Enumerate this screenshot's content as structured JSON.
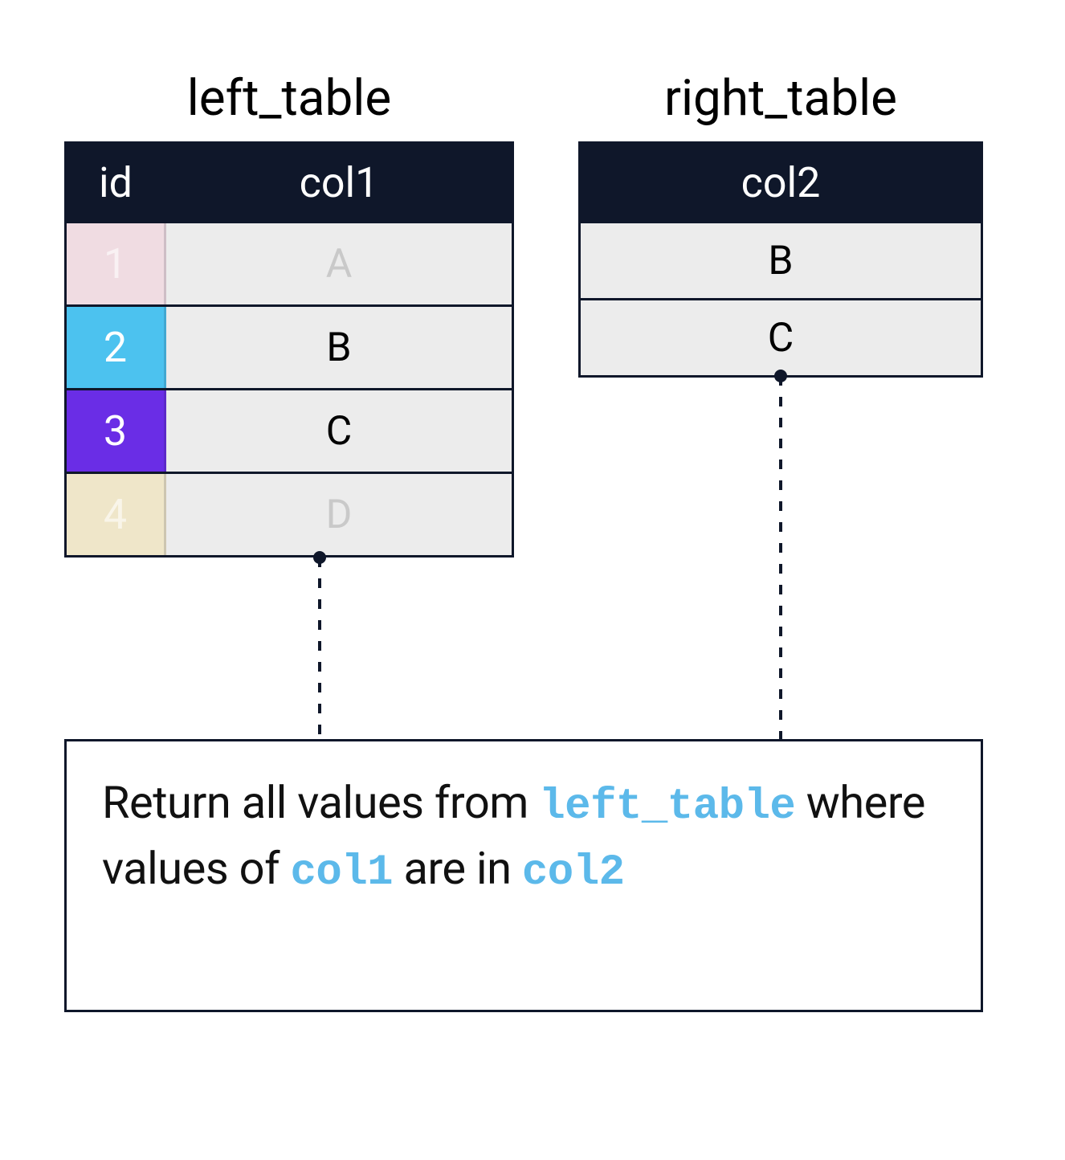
{
  "left_table": {
    "title": "left_table",
    "headers": {
      "id": "id",
      "col1": "col1"
    },
    "rows": [
      {
        "id": "1",
        "col1": "A",
        "id_bg": "#f0dce2",
        "faded": true
      },
      {
        "id": "2",
        "col1": "B",
        "id_bg": "#4cc2ef",
        "faded": false
      },
      {
        "id": "3",
        "col1": "C",
        "id_bg": "#6a2de6",
        "faded": false
      },
      {
        "id": "4",
        "col1": "D",
        "id_bg": "#efe6c9",
        "faded": true
      }
    ]
  },
  "right_table": {
    "title": "right_table",
    "headers": {
      "col2": "col2"
    },
    "rows": [
      {
        "col2": "B"
      },
      {
        "col2": "C"
      }
    ]
  },
  "explanation": {
    "part1": "Return all values from ",
    "token1": "left_table",
    "part2": " where values of ",
    "token2": "col1",
    "part3": "  are in ",
    "token3": "col2"
  },
  "colors": {
    "header_bg": "#0f172a",
    "cell_bg": "#ececec",
    "accent_code": "#5cb9ea"
  }
}
